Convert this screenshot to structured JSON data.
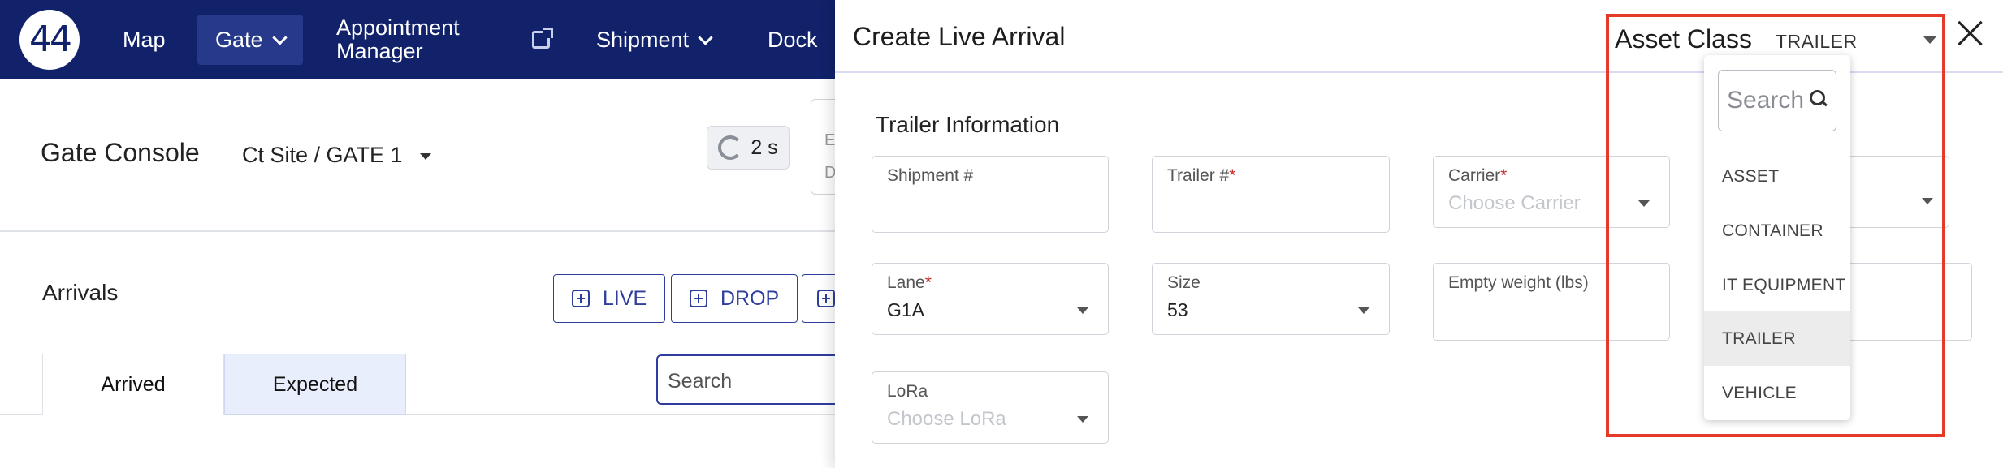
{
  "nav": {
    "logo_text": "44",
    "items": [
      {
        "label": "Map"
      },
      {
        "label": "Gate"
      },
      {
        "label_line1": "Appointment",
        "label_line2": "Manager"
      },
      {
        "label": "Shipment"
      },
      {
        "label": "Dock"
      }
    ]
  },
  "page": {
    "title": "Gate Console",
    "site": "Ct Site / GATE 1",
    "refresh_text": "2 s",
    "cut_box_lines": [
      "E",
      "D"
    ],
    "arrivals_title": "Arrivals",
    "buttons": [
      "LIVE",
      "DROP"
    ],
    "tabs": [
      "Arrived",
      "Expected"
    ],
    "search_placeholder": "Search"
  },
  "drawer": {
    "title": "Create Live Arrival",
    "asset_class_label": "Asset Class",
    "asset_class_value": "TRAILER",
    "section": "Trailer Information",
    "fields": {
      "shipment": {
        "label": "Shipment #",
        "value": ""
      },
      "trailer": {
        "label": "Trailer #",
        "required": "*",
        "value": ""
      },
      "carrier": {
        "label": "Carrier",
        "required": "*",
        "placeholder": "Choose Carrier"
      },
      "lane": {
        "label": "Lane",
        "required": "*",
        "value": "G1A"
      },
      "size": {
        "label": "Size",
        "value": "53"
      },
      "empty_weight": {
        "label": "Empty weight (lbs)",
        "value": ""
      },
      "lora": {
        "label": "LoRa",
        "placeholder": "Choose LoRa"
      }
    }
  },
  "asset_menu": {
    "search_placeholder": "Search",
    "options": [
      "ASSET",
      "CONTAINER",
      "IT EQUIPMENT",
      "TRAILER",
      "VEHICLE"
    ],
    "selected": "TRAILER"
  },
  "colors": {
    "nav_bg": "#11226b",
    "accent": "#2f3e9e",
    "highlight": "#e53a2a",
    "required": "#c62828"
  }
}
